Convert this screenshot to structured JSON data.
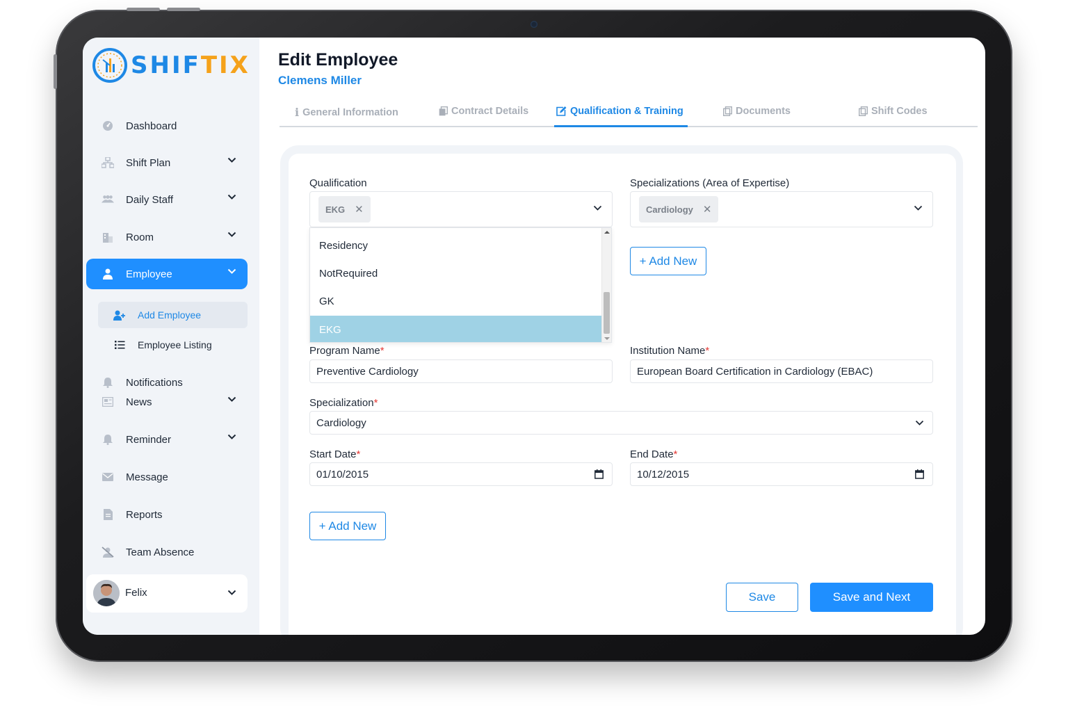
{
  "app": {
    "name_part1": "SHIF",
    "name_part2": "TIX"
  },
  "sidebar": {
    "items": [
      {
        "label": "Dashboard",
        "icon": "dashboard-icon"
      },
      {
        "label": "Shift Plan",
        "icon": "sitemap-icon"
      },
      {
        "label": "Daily Staff",
        "icon": "users-icon"
      },
      {
        "label": "Room",
        "icon": "building-icon"
      },
      {
        "label": "Employee",
        "icon": "user-icon"
      },
      {
        "label": "Notifications",
        "icon": "bell-icon"
      },
      {
        "label": "News",
        "icon": "newspaper-icon"
      },
      {
        "label": "Reminder",
        "icon": "bell-icon"
      },
      {
        "label": "Message",
        "icon": "envelope-icon"
      },
      {
        "label": "Reports",
        "icon": "file-icon"
      },
      {
        "label": "Team Absence",
        "icon": "user-slash-icon"
      }
    ],
    "employee_sub": [
      {
        "label": "Add Employee",
        "icon": "user-plus-icon"
      },
      {
        "label": "Employee Listing",
        "icon": "list-icon"
      }
    ],
    "user": {
      "name": "Felix"
    }
  },
  "header": {
    "title": "Edit Employee",
    "employee_name": "Clemens Miller"
  },
  "tabs": [
    {
      "label": "General Information"
    },
    {
      "label": "Contract Details"
    },
    {
      "label": "Qualification & Training"
    },
    {
      "label": "Documents"
    },
    {
      "label": "Shift Codes"
    }
  ],
  "form": {
    "qualification": {
      "label": "Qualification",
      "selected_chip": "EKG",
      "options": [
        "Residency",
        "NotRequired",
        "GK",
        "EKG"
      ]
    },
    "specializations": {
      "label": "Specializations (Area of Expertise)",
      "selected_chip": "Cardiology"
    },
    "add_new_label": "+ Add New",
    "program_name": {
      "label": "Program Name",
      "value": "Preventive Cardiology"
    },
    "institution_name": {
      "label": "Institution Name",
      "value": "European Board Certification in Cardiology (EBAC)"
    },
    "specialization": {
      "label": "Specialization",
      "value": "Cardiology"
    },
    "start_date": {
      "label": "Start Date",
      "value": "01/10/2015"
    },
    "end_date": {
      "label": "End Date",
      "value": "10/12/2015"
    },
    "required_mark": "*",
    "save_label": "Save",
    "save_next_label": "Save and Next"
  },
  "colors": {
    "accent": "#1f8fff",
    "brand_orange": "#f5a21b",
    "selected_option": "#9fd2e5"
  }
}
